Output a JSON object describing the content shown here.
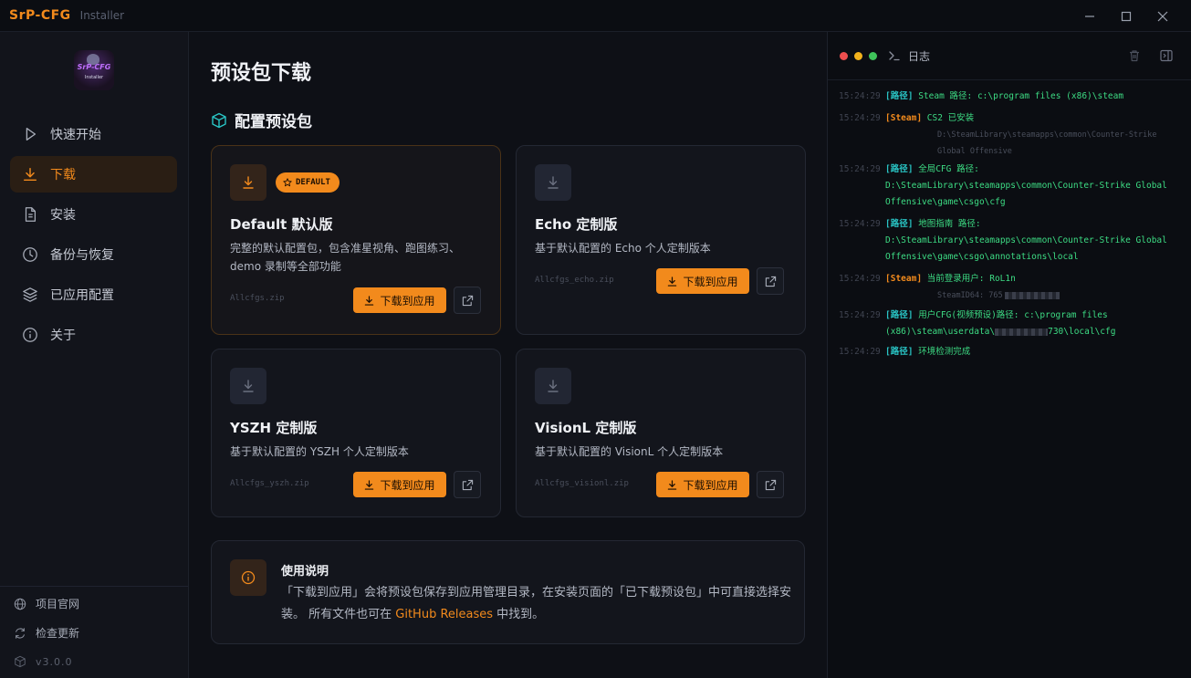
{
  "titlebar": {
    "brand": "SrP-CFG",
    "subtitle": "Installer"
  },
  "sidebar": {
    "logo": {
      "line1": "SrP-CFG",
      "line2": "Installer"
    },
    "items": [
      {
        "label": "快速开始",
        "icon": "play-icon"
      },
      {
        "label": "下载",
        "icon": "download-icon",
        "active": true
      },
      {
        "label": "安装",
        "icon": "file-icon"
      },
      {
        "label": "备份与恢复",
        "icon": "clock-icon"
      },
      {
        "label": "已应用配置",
        "icon": "layers-icon"
      },
      {
        "label": "关于",
        "icon": "info-icon"
      }
    ],
    "footer": {
      "website": "项目官网",
      "check_update": "检查更新",
      "version": "v3.0.0"
    }
  },
  "main": {
    "title": "预设包下载",
    "section_title": "配置预设包",
    "cards": [
      {
        "title": "Default 默认版",
        "badge": "DEFAULT",
        "desc": "完整的默认配置包，包含准星视角、跑图练习、demo 录制等全部功能",
        "file": "Allcfgs.zip",
        "button": "下载到应用"
      },
      {
        "title": "Echo 定制版",
        "desc": "基于默认配置的 Echo 个人定制版本",
        "file": "Allcfgs_echo.zip",
        "button": "下载到应用"
      },
      {
        "title": "YSZH 定制版",
        "desc": "基于默认配置的 YSZH 个人定制版本",
        "file": "Allcfgs_yszh.zip",
        "button": "下载到应用"
      },
      {
        "title": "VisionL 定制版",
        "desc": "基于默认配置的 VisionL 个人定制版本",
        "file": "Allcfgs_visionl.zip",
        "button": "下载到应用"
      }
    ],
    "info": {
      "title": "使用说明",
      "text_before": "「下载到应用」会将预设包保存到应用管理目录，在安装页面的「已下载预设包」中可直接选择安装。 所有文件也可在 ",
      "link": "GitHub Releases",
      "text_after": " 中找到。"
    }
  },
  "log": {
    "title": "日志",
    "entries": [
      {
        "time": "15:24:29",
        "tag": "[路径]",
        "text": "Steam 路径: c:\\program files (x86)\\steam"
      },
      {
        "time": "15:24:29",
        "tag": "[Steam]",
        "text": "CS2 已安装",
        "sub": "D:\\SteamLibrary\\steamapps\\common\\Counter-Strike Global Offensive"
      },
      {
        "time": "15:24:29",
        "tag": "[路径]",
        "text": "全局CFG 路径:",
        "cont": "D:\\SteamLibrary\\steamapps\\common\\Counter-Strike Global Offensive\\game\\csgo\\cfg"
      },
      {
        "time": "15:24:29",
        "tag": "[路径]",
        "text": "地图指南 路径:",
        "cont": "D:\\SteamLibrary\\steamapps\\common\\Counter-Strike Global Offensive\\game\\csgo\\annotations\\local"
      },
      {
        "time": "15:24:29",
        "tag": "[Steam]",
        "text": "当前登录用户: RoL1n",
        "sub": "SteamID64: 765"
      },
      {
        "time": "15:24:29",
        "tag": "[路径]",
        "text": "用户CFG(视频预设)路径: c:\\program files",
        "cont_a": "(x86)\\steam\\userdata\\",
        "cont_b": "730\\local\\cfg"
      },
      {
        "time": "15:24:29",
        "tag": "[路径]",
        "text": "环境检测完成"
      }
    ]
  },
  "colors": {
    "accent": "#f28a1c",
    "log_green": "#3ddc84",
    "log_cyan": "#29c4c4"
  }
}
